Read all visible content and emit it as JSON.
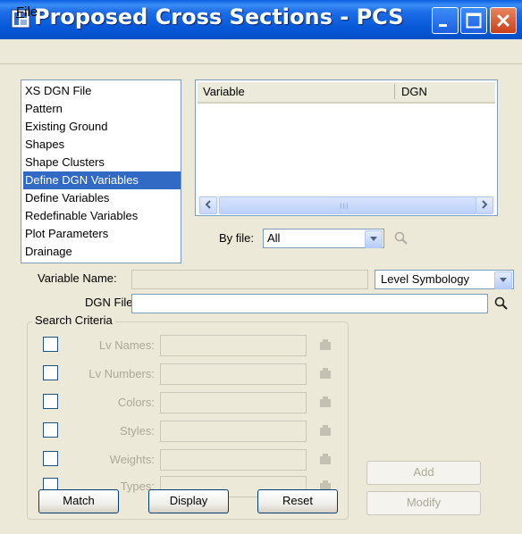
{
  "window": {
    "title": "Proposed Cross Sections - PCS",
    "controls": [
      "minimize",
      "maximize",
      "close"
    ]
  },
  "menu": {
    "file": "File"
  },
  "categories": {
    "items": [
      {
        "label": "XS DGN File"
      },
      {
        "label": "Pattern"
      },
      {
        "label": "Existing Ground"
      },
      {
        "label": "Shapes"
      },
      {
        "label": "Shape Clusters"
      },
      {
        "label": "Define DGN Variables",
        "selected": true
      },
      {
        "label": "Define Variables"
      },
      {
        "label": "Redefinable Variables"
      },
      {
        "label": "Plot Parameters"
      },
      {
        "label": "Drainage"
      }
    ]
  },
  "variables_table": {
    "columns": [
      "Variable",
      "DGN"
    ],
    "rows": [],
    "scroll_grip": "III"
  },
  "by_file": {
    "label": "By file:",
    "value": "All"
  },
  "variable_name": {
    "label": "Variable Name:",
    "value": ""
  },
  "level_symbology": {
    "value": "Level Symbology"
  },
  "dgn_file": {
    "label": "DGN File:",
    "value": ""
  },
  "search_criteria": {
    "title": "Search Criteria",
    "rows": [
      {
        "label": "Lv Names:",
        "value": "",
        "checked": false
      },
      {
        "label": "Lv Numbers:",
        "value": "",
        "checked": false
      },
      {
        "label": "Colors:",
        "value": "",
        "checked": false
      },
      {
        "label": "Styles:",
        "value": "",
        "checked": false
      },
      {
        "label": "Weights:",
        "value": "",
        "checked": false
      },
      {
        "label": "Types:",
        "value": "",
        "checked": false
      }
    ],
    "match": "Match",
    "display": "Display",
    "reset": "Reset"
  },
  "actions": {
    "add": "Add",
    "modify": "Modify"
  },
  "icons": {
    "app": "bentley-app-icon",
    "search": "magnifier-icon",
    "pick": "level-picker-icon"
  },
  "colors": {
    "title_bar": "#0A5FE6",
    "selection": "#316AC5",
    "close_button": "#D85A2F"
  }
}
